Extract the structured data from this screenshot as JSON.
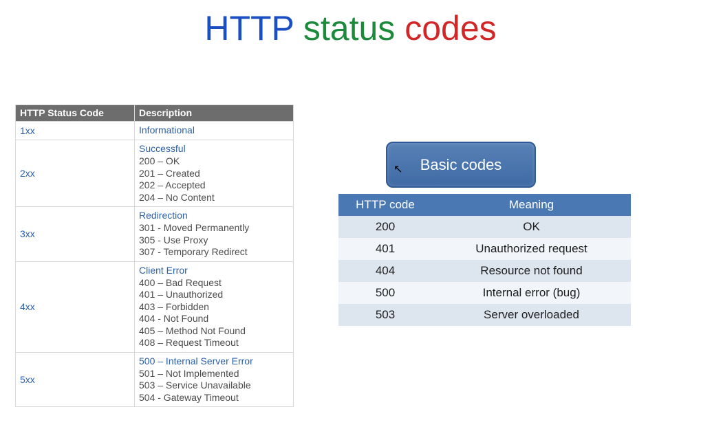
{
  "title": {
    "w1": "HTTP",
    "w2": "status",
    "w3": "codes"
  },
  "detail_table": {
    "headers": {
      "code": "HTTP Status Code",
      "desc": "Description"
    },
    "rows": [
      {
        "code": "1xx",
        "category": "Informational",
        "items": []
      },
      {
        "code": "2xx",
        "category": "Successful",
        "items": [
          "200 – OK",
          "201 – Created",
          "202 – Accepted",
          "204 – No Content"
        ]
      },
      {
        "code": "3xx",
        "category": "Redirection",
        "items": [
          "301 - Moved Permanently",
          "305 - Use Proxy",
          "307 - Temporary Redirect"
        ]
      },
      {
        "code": "4xx",
        "category": "Client Error",
        "items": [
          "400 – Bad Request",
          "401 – Unauthorized",
          "403 – Forbidden",
          "404 - Not Found",
          "405 – Method Not Found",
          "408 – Request Timeout"
        ]
      },
      {
        "code": "5xx",
        "category": "500 – Internal Server Error",
        "items": [
          "501 – Not Implemented",
          "503 – Service Unavailable",
          "504 - Gateway Timeout"
        ]
      }
    ]
  },
  "basic_codes": {
    "label": "Basic codes",
    "headers": {
      "code": "HTTP code",
      "meaning": "Meaning"
    },
    "rows": [
      {
        "code": "200",
        "meaning": "OK"
      },
      {
        "code": "401",
        "meaning": "Unauthorized request"
      },
      {
        "code": "404",
        "meaning": "Resource not found"
      },
      {
        "code": "500",
        "meaning": "Internal error (bug)"
      },
      {
        "code": "503",
        "meaning": "Server overloaded"
      }
    ]
  }
}
